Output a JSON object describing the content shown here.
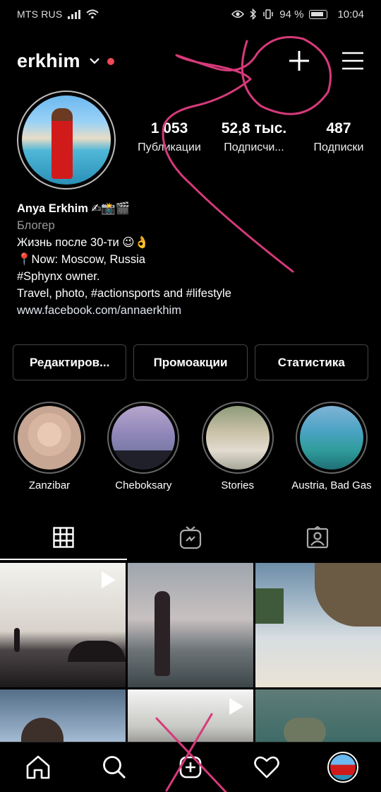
{
  "status_bar": {
    "carrier": "MTS RUS",
    "battery": "94 %",
    "time": "10:04"
  },
  "header": {
    "username": "erkhim"
  },
  "stats": [
    {
      "value": "1 053",
      "label": "Публикации"
    },
    {
      "value": "52,8 тыс.",
      "label": "Подписчи..."
    },
    {
      "value": "487",
      "label": "Подписки"
    }
  ],
  "bio": {
    "name": "Anya Erkhim ✍📸🎬",
    "category": "Блогер",
    "lines": [
      "Жизнь после 30-ти 😉👌",
      "📍Now: Moscow, Russia",
      "#Sphynx owner.",
      "Travel, photo, #actionsports and #lifestyle"
    ],
    "link": "www.facebook.com/annaerkhim"
  },
  "buttons": {
    "edit": "Редактиров...",
    "promo": "Промоакции",
    "stats": "Статистика"
  },
  "highlights": [
    {
      "label": "Zanzibar"
    },
    {
      "label": "Cheboksary"
    },
    {
      "label": "Stories"
    },
    {
      "label": "Austria, Bad Gas"
    }
  ],
  "colors": {
    "background": "#000000",
    "notification_dot": "#ed4956",
    "scribble": "#d63a7a"
  }
}
